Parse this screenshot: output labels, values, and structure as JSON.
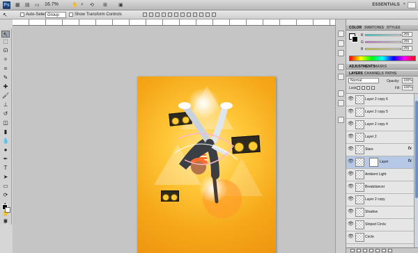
{
  "app": {
    "logo": "Ps",
    "zoom": "16.7%",
    "workspace": "ESSENTIALS",
    "icons": [
      "bridge-icon",
      "mini-bridge-icon",
      "frame-icon",
      "hand-icon",
      "zoom-icon",
      "rotate-icon",
      "arrange-icon",
      "screen-mode-icon"
    ]
  },
  "options": {
    "auto_select_label": "Auto-Select:",
    "auto_select_value": "Group",
    "transform_label": "Show Transform Controls"
  },
  "color_panel": {
    "tabs": [
      "COLOR",
      "SWATCHES",
      "STYLES"
    ],
    "sliders": [
      {
        "label": "R",
        "value": "255",
        "color": "#ff8bf0"
      },
      {
        "label": "G",
        "value": "255",
        "color": "#7dffff"
      },
      {
        "label": "B",
        "value": "255",
        "color": "#fff67a"
      }
    ]
  },
  "adjust_panel": {
    "tabs": [
      "ADJUSTMENTS",
      "MASKS"
    ]
  },
  "layers_panel": {
    "tabs": [
      "LAYERS",
      "CHANNELS",
      "PATHS"
    ],
    "blend_mode": "Normal",
    "opacity_label": "Opacity:",
    "opacity": "100%",
    "lock_label": "Lock:",
    "fill_label": "Fill:",
    "fill": "100%",
    "layers": [
      {
        "name": "Layer 2 copy 6",
        "fx": ""
      },
      {
        "name": "Layer 2 copy 5",
        "fx": ""
      },
      {
        "name": "Layer 2 copy 4",
        "fx": ""
      },
      {
        "name": "Layer 2",
        "fx": ""
      },
      {
        "name": "Stars",
        "fx": "fx"
      },
      {
        "name": "Layer",
        "fx": "fx"
      },
      {
        "name": "Ambient Light",
        "fx": ""
      },
      {
        "name": "Breakdancer",
        "fx": ""
      },
      {
        "name": "Layer 2 copy",
        "fx": ""
      },
      {
        "name": "Shadow",
        "fx": ""
      },
      {
        "name": "Striped Circle",
        "fx": ""
      },
      {
        "name": "Circle",
        "fx": ""
      }
    ]
  }
}
